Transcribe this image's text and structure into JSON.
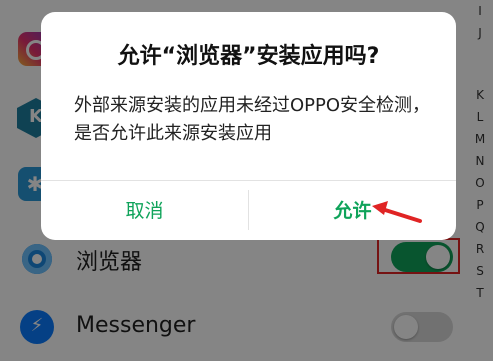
{
  "app_list": [
    {
      "label": "",
      "icon": "instagram-icon"
    },
    {
      "label": "",
      "icon": "hex-app-icon"
    },
    {
      "label": "",
      "icon": "bluetooth-icon"
    },
    {
      "label": "浏览器",
      "icon": "browser-icon",
      "toggle": "on"
    },
    {
      "label": "Messenger",
      "icon": "messenger-icon",
      "toggle": "off"
    }
  ],
  "alphabet": [
    "I",
    "J",
    "K",
    "L",
    "M",
    "N",
    "O",
    "P",
    "Q",
    "R",
    "S",
    "T"
  ],
  "dialog": {
    "title": "允许“浏览器”安装应用吗?",
    "message": "外部来源安装的应用未经过OPPO安全检测，是否允许此来源安装应用",
    "cancel_label": "取消",
    "allow_label": "允许"
  },
  "colors": {
    "accent": "#0fa35a",
    "toggle_on": "#11a35a",
    "annotation_red": "#e02424"
  }
}
